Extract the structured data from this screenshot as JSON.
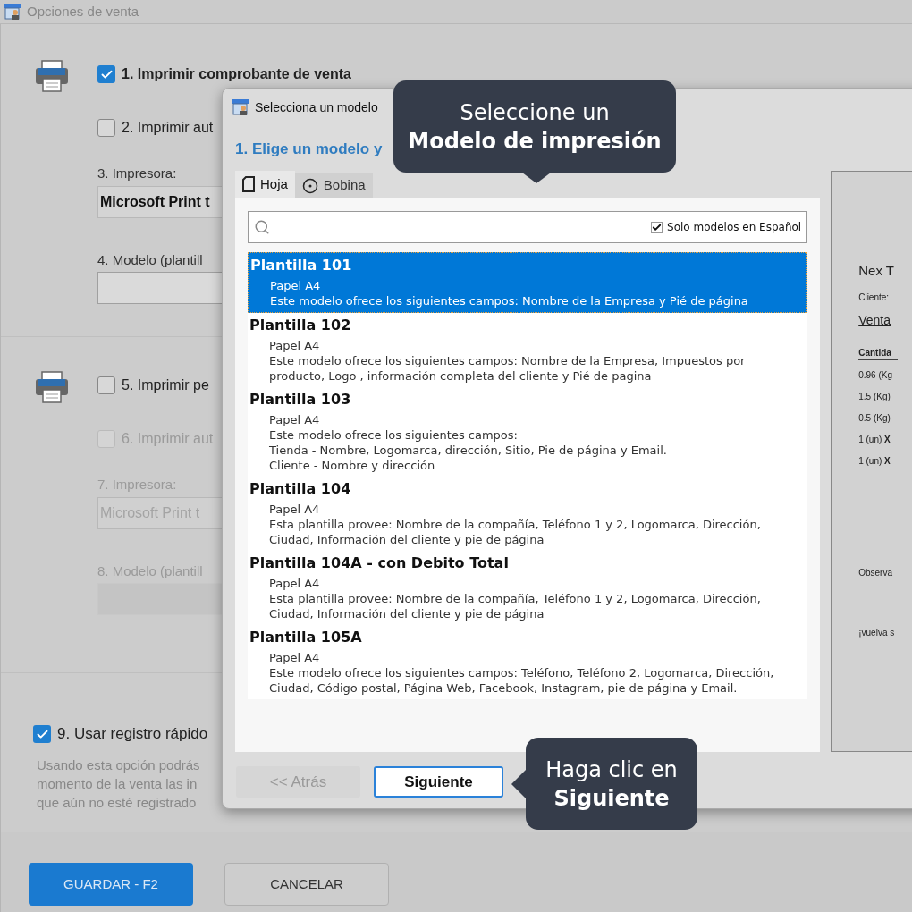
{
  "window": {
    "title": "Opciones de venta"
  },
  "section_1": {
    "options": [
      {
        "label": "1. Imprimir comprobante de venta",
        "checked": true,
        "disabled": false
      },
      {
        "label": "2. Imprimir aut",
        "checked": false,
        "disabled": false
      }
    ],
    "printer": {
      "label": "3. Impresora:",
      "value": "Microsoft Print t",
      "disabled": false
    },
    "model": {
      "label": "4. Modelo (plantill",
      "disabled": false
    }
  },
  "section_2": {
    "options": [
      {
        "label": "5. Imprimir pe",
        "checked": false,
        "disabled": false
      },
      {
        "label": "6. Imprimir aut",
        "checked": false,
        "disabled": true
      }
    ],
    "printer": {
      "label": "7. Impresora:",
      "value": "Microsoft Print t",
      "disabled": true
    },
    "model": {
      "label": "8. Modelo (plantill",
      "disabled": true
    }
  },
  "quick_register": {
    "label": "9. Usar registro rápido",
    "checked": true,
    "description": [
      "Usando esta opción podrás",
      "momento de la venta las in",
      "que aún no esté registrado"
    ]
  },
  "footer_buttons": [
    {
      "label": "GUARDAR - F2",
      "kind": "primary"
    },
    {
      "label": "CANCELAR",
      "kind": "secondary"
    }
  ],
  "dialog": {
    "title": "Selecciona un modelo",
    "heading": "1. Elige un modelo y",
    "tabs": [
      {
        "label": "Hoja",
        "kind": "sheet",
        "selected": true
      },
      {
        "label": "Bobina",
        "kind": "roll",
        "selected": false
      }
    ],
    "spanish_only": {
      "label": "Solo modelos en Español",
      "checked": true
    },
    "templates": [
      {
        "name": "Plantilla 101",
        "paper": "Papel A4",
        "description": [
          "Este modelo ofrece los siguientes campos: Nombre de la Empresa y Pié de página"
        ],
        "selected": true
      },
      {
        "name": "Plantilla 102",
        "paper": "Papel A4",
        "description": [
          "Este modelo ofrece los siguientes campos: Nombre de la Empresa, Impuestos por",
          "producto, Logo , información completa del cliente y Pié de pagina"
        ],
        "selected": false
      },
      {
        "name": "Plantilla 103",
        "paper": "Papel A4",
        "description": [
          "Este modelo ofrece los siguientes campos:",
          "Tienda - Nombre, Logomarca, dirección, Sitio, Pie de página y Email.",
          "Cliente - Nombre y dirección"
        ],
        "selected": false
      },
      {
        "name": "Plantilla 104",
        "paper": "Papel A4",
        "description": [
          "Esta plantilla provee: Nombre de la compañía, Teléfono 1 y 2, Logomarca, Dirección,",
          "Ciudad, Información del cliente y pie de página"
        ],
        "selected": false
      },
      {
        "name": "Plantilla 104A - con Debito Total",
        "paper": "Papel A4",
        "description": [
          "Esta plantilla provee: Nombre de la compañía, Teléfono 1 y 2, Logomarca, Dirección,",
          "Ciudad, Información del cliente y pie de página"
        ],
        "selected": false
      },
      {
        "name": "Plantilla 105A",
        "paper": "Papel A4",
        "description": [
          "Este modelo ofrece los siguientes campos: Teléfono, Teléfono 2, Logomarca, Dirección,",
          "Ciudad, Código postal, Página Web, Facebook, Instagram, pie de página y Email."
        ],
        "selected": false
      }
    ],
    "preview": {
      "company": "Nex T",
      "client": "Cliente:",
      "sale": "Venta",
      "column": "Cantida",
      "rows": [
        "0.96 (Kg",
        "1.5 (Kg)",
        "0.5 (Kg)",
        "1 (un) **X**",
        "1 (un) **X**"
      ],
      "notes": "Observa",
      "farewell": "¡vuelva s"
    },
    "buttons": [
      {
        "label": "<< Atrás",
        "disabled": true
      },
      {
        "label": "Siguiente",
        "disabled": false
      }
    ]
  },
  "tooltips": [
    {
      "line_1": "Seleccione un",
      "line_2": "Modelo de impresión",
      "kind": "down"
    },
    {
      "line_1": "Haga clic en",
      "line_2": "Siguiente",
      "kind": "left"
    }
  ]
}
